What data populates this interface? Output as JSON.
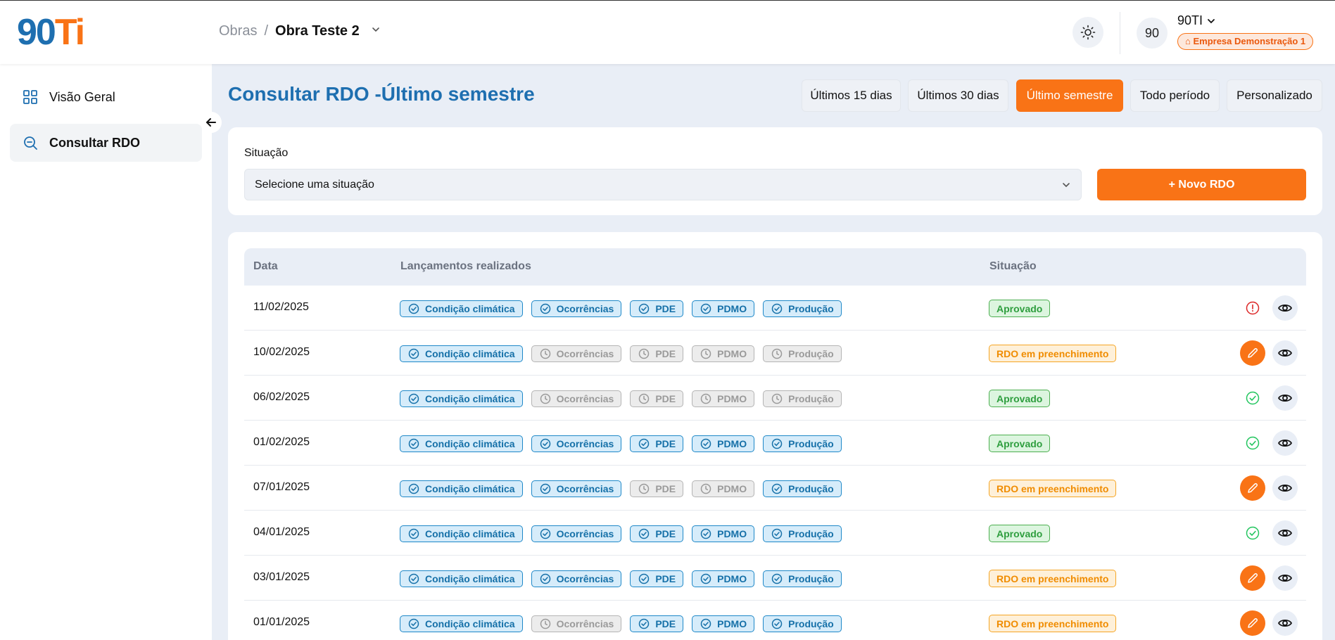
{
  "header": {
    "logo_left": "90",
    "logo_right": "Ti",
    "breadcrumb_root": "Obras",
    "breadcrumb_sep": "/",
    "breadcrumb_current": "Obra Teste 2",
    "avatar_initials": "90",
    "user_name": "90TI",
    "company_badge": "Empresa Demonstração 1"
  },
  "sidebar": {
    "items": [
      {
        "label": "Visão Geral",
        "icon": "grid-icon",
        "active": false
      },
      {
        "label": "Consultar RDO",
        "icon": "search-doc-icon",
        "active": true
      }
    ]
  },
  "page": {
    "title": "Consultar RDO -",
    "subtitle": "Último semestre"
  },
  "periods": [
    {
      "label": "Últimos 15 dias",
      "active": false
    },
    {
      "label": "Últimos 30 dias",
      "active": false
    },
    {
      "label": "Último semestre",
      "active": true
    },
    {
      "label": "Todo período",
      "active": false
    },
    {
      "label": "Personalizado",
      "active": false
    }
  ],
  "filter": {
    "label": "Situação",
    "placeholder": "Selecione uma situação",
    "new_button": "+ Novo RDO"
  },
  "table": {
    "headers": {
      "date": "Data",
      "entries": "Lançamentos realizados",
      "status": "Situação"
    },
    "entry_labels": [
      "Condição climática",
      "Ocorrências",
      "PDE",
      "PDMO",
      "Produção"
    ],
    "rows": [
      {
        "date": "11/02/2025",
        "entries": [
          true,
          true,
          true,
          true,
          true
        ],
        "status": "Aprovado",
        "status_kind": "approved",
        "action": "info"
      },
      {
        "date": "10/02/2025",
        "entries": [
          true,
          false,
          false,
          false,
          false
        ],
        "status": "RDO em preenchimento",
        "status_kind": "filling",
        "action": "edit"
      },
      {
        "date": "06/02/2025",
        "entries": [
          true,
          false,
          false,
          false,
          false
        ],
        "status": "Aprovado",
        "status_kind": "approved",
        "action": "check"
      },
      {
        "date": "01/02/2025",
        "entries": [
          true,
          true,
          true,
          true,
          true
        ],
        "status": "Aprovado",
        "status_kind": "approved",
        "action": "check"
      },
      {
        "date": "07/01/2025",
        "entries": [
          true,
          true,
          false,
          false,
          true
        ],
        "status": "RDO em preenchimento",
        "status_kind": "filling",
        "action": "edit"
      },
      {
        "date": "04/01/2025",
        "entries": [
          true,
          true,
          true,
          true,
          true
        ],
        "status": "Aprovado",
        "status_kind": "approved",
        "action": "check"
      },
      {
        "date": "03/01/2025",
        "entries": [
          true,
          true,
          true,
          true,
          true
        ],
        "status": "RDO em preenchimento",
        "status_kind": "filling",
        "action": "edit"
      },
      {
        "date": "01/01/2025",
        "entries": [
          true,
          false,
          true,
          true,
          true
        ],
        "status": "RDO em preenchimento",
        "status_kind": "filling",
        "action": "edit"
      }
    ]
  },
  "colors": {
    "brand_blue": "#1e6fb0",
    "brand_orange": "#f97316",
    "approved_green": "#2e9e3e",
    "filling_orange": "#f08c00",
    "alert_red": "#dc2626"
  }
}
